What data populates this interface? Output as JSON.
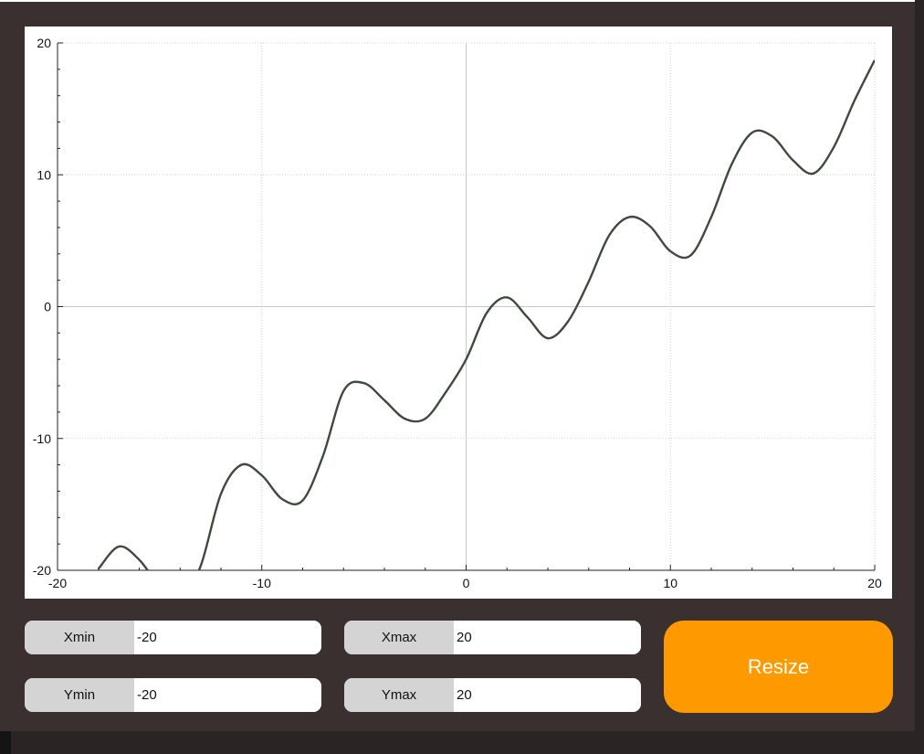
{
  "chart_data": {
    "type": "line",
    "xlim": [
      -20,
      20
    ],
    "ylim": [
      -20,
      20
    ],
    "x_ticks": [
      "-20",
      "-10",
      "0",
      "10",
      "20"
    ],
    "y_ticks": [
      "20",
      "10",
      "0",
      "-10",
      "-20"
    ],
    "grid": true,
    "series": [
      {
        "color": "#3d4a3d",
        "x": [
          -18,
          -17,
          -16,
          -15,
          -14,
          -13,
          -12,
          -11,
          -10,
          -9,
          -8,
          -7,
          -6,
          -5,
          -4,
          -3,
          -2,
          -1,
          0,
          1,
          2,
          3,
          4,
          5,
          6,
          7,
          8,
          9,
          10,
          11,
          12,
          13,
          14,
          15,
          16,
          17,
          18,
          19,
          20
        ],
        "y": [
          -19.9,
          -18.2,
          -19.2,
          -21.2,
          -22.3,
          -19.7,
          -14.2,
          -12.0,
          -12.8,
          -14.6,
          -14.7,
          -11.3,
          -6.4,
          -5.8,
          -7.1,
          -8.5,
          -8.5,
          -6.5,
          -4.0,
          -0.5,
          0.7,
          -0.8,
          -2.4,
          -1.1,
          1.9,
          5.4,
          6.8,
          6.1,
          4.2,
          3.9,
          6.8,
          10.8,
          13.2,
          12.9,
          11.1,
          10.1,
          12.1,
          15.6,
          18.7
        ]
      }
    ]
  },
  "controls": {
    "xmin": {
      "label": "Xmin",
      "value": "-20"
    },
    "xmax": {
      "label": "Xmax",
      "value": "20"
    },
    "ymin": {
      "label": "Ymin",
      "value": "-20"
    },
    "ymax": {
      "label": "Ymax",
      "value": "20"
    },
    "resize_label": "Resize"
  }
}
